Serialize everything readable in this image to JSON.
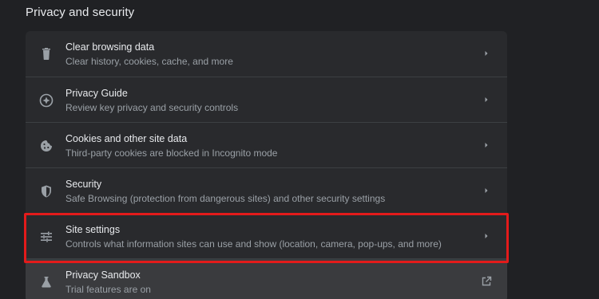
{
  "section": {
    "title": "Privacy and security"
  },
  "rows": [
    {
      "title": "Clear browsing data",
      "subtitle": "Clear history, cookies, cache, and more",
      "icon": "trash-icon",
      "action": "chevron-right-icon"
    },
    {
      "title": "Privacy Guide",
      "subtitle": "Review key privacy and security controls",
      "icon": "compass-icon",
      "action": "chevron-right-icon"
    },
    {
      "title": "Cookies and other site data",
      "subtitle": "Third-party cookies are blocked in Incognito mode",
      "icon": "cookie-icon",
      "action": "chevron-right-icon"
    },
    {
      "title": "Security",
      "subtitle": "Safe Browsing (protection from dangerous sites) and other security settings",
      "icon": "shield-icon",
      "action": "chevron-right-icon"
    },
    {
      "title": "Site settings",
      "subtitle": "Controls what information sites can use and show (location, camera, pop-ups, and more)",
      "icon": "tune-icon",
      "action": "chevron-right-icon",
      "highlighted": true
    },
    {
      "title": "Privacy Sandbox",
      "subtitle": "Trial features are on",
      "icon": "flask-icon",
      "action": "open-in-new-icon"
    }
  ],
  "colors": {
    "background": "#202124",
    "card": "#292a2d",
    "text_primary": "#e8eaed",
    "text_secondary": "#9aa0a6",
    "highlight_border": "#e31b1b"
  }
}
